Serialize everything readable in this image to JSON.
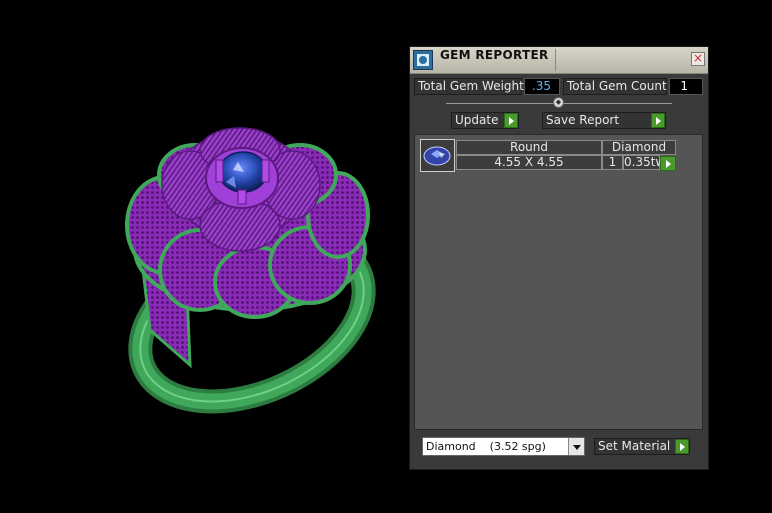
{
  "window": {
    "title": "GEM REPORTER",
    "close_label": "×",
    "icon": "gem-reporter-icon"
  },
  "totals": {
    "weight_label": "Total Gem Weight",
    "weight_value": ".35",
    "count_label": "Total Gem Count",
    "count_value": "1"
  },
  "slider": {
    "handle_glyph": "◆"
  },
  "actions": {
    "update_label": "Update",
    "save_report_label": "Save Report"
  },
  "gems": [
    {
      "shape": "Round",
      "material": "Diamond",
      "size": "4.55 X 4.55",
      "count": "1",
      "weight": "0.35tw"
    }
  ],
  "material_select": {
    "selected": "Diamond    (3.52 spg)"
  },
  "set_material_label": "Set Material",
  "colors": {
    "ring_metal": "#3fa85a",
    "ring_filigree": "#8a2bb8",
    "gem": "#2244aa",
    "panel_bg": "#3a3a3a",
    "accent_green": "#4a9a2e",
    "value_blue": "#58b7e8"
  }
}
